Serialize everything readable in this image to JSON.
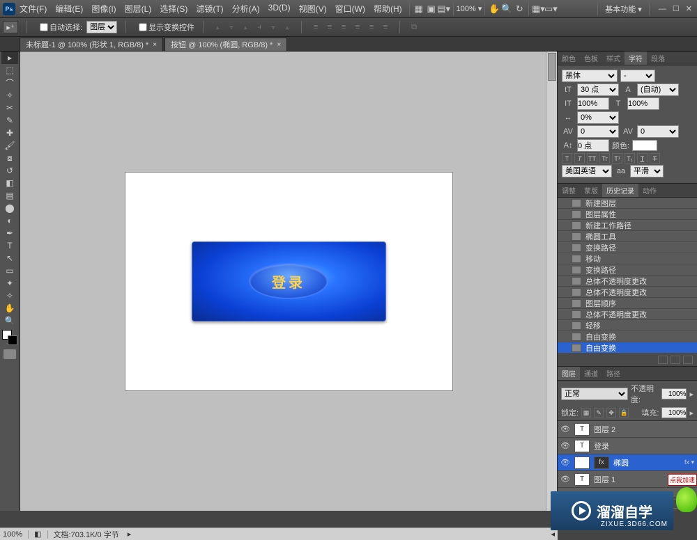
{
  "menu": {
    "items": [
      "文件(F)",
      "编辑(E)",
      "图像(I)",
      "图层(L)",
      "选择(S)",
      "滤镜(T)",
      "分析(A)",
      "3D(D)",
      "视图(V)",
      "窗口(W)",
      "帮助(H)"
    ]
  },
  "topbar": {
    "zoom": "100% ▾",
    "workspace": "基本功能 ▾"
  },
  "optionbar": {
    "auto_select": "自动选择:",
    "target": "图层",
    "show_controls": "显示变换控件"
  },
  "tabs": [
    {
      "label": "未标题-1 @ 100% (形状 1, RGB/8) *"
    },
    {
      "label": "按钮 @ 100% (椭圆, RGB/8) *"
    }
  ],
  "canvas": {
    "button_text": "登录"
  },
  "char": {
    "tabs": [
      "颜色",
      "色板",
      "样式",
      "字符",
      "段落"
    ],
    "font": "黑体",
    "size": "30 点",
    "leading": "(自动)",
    "vscale": "100%",
    "hscale": "100%",
    "tracking": "0%",
    "kerning": "0",
    "baseline": "0",
    "hshift": "0 点",
    "color_label": "颜色:",
    "lang": "美国英语",
    "aa": "平滑"
  },
  "history": {
    "tabs": [
      "调整",
      "蒙版",
      "历史记录",
      "动作"
    ],
    "items": [
      "新建图层",
      "图层属性",
      "新建工作路径",
      "椭圆工具",
      "变换路径",
      "移动",
      "变换路径",
      "总体不透明度更改",
      "总体不透明度更改",
      "图层顺序",
      "总体不透明度更改",
      "轻移",
      "自由变换",
      "自由变换"
    ]
  },
  "layers": {
    "tabs": [
      "图层",
      "通道",
      "路径"
    ],
    "blend": "正常",
    "opacity_label": "不透明度:",
    "opacity": "100%",
    "lock_label": "锁定:",
    "fill_label": "填充:",
    "fill": "100%",
    "items": [
      {
        "name": "图层 2",
        "type": "T",
        "sel": false
      },
      {
        "name": "登录",
        "type": "T",
        "sel": false
      },
      {
        "name": "椭圆",
        "type": "S",
        "sel": true,
        "fx": true
      },
      {
        "name": "图层 1",
        "type": "T",
        "sel": false
      }
    ]
  },
  "status": {
    "zoom": "100%",
    "doc": "文档:703.1K/0 字节"
  },
  "watermark": {
    "text": "溜溜自学",
    "url": "ZIXUE.3D66.COM",
    "badge": "点我加速"
  }
}
